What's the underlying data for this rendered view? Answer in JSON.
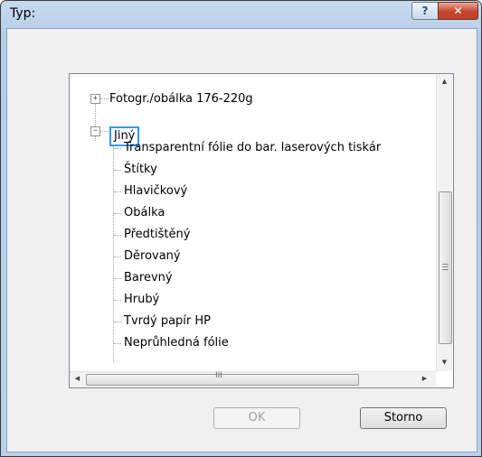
{
  "window": {
    "title": "Typ:",
    "help_label": "?",
    "close_label": "✕"
  },
  "tree": {
    "collapsed_item": "Fotogr./obálka 176-220g",
    "selected_item": "Jiný",
    "expander_plus": "+",
    "expander_minus": "−",
    "children": [
      "Transparentní fólie do bar. laserových tiskár",
      "Štítky",
      "Hlavičkový",
      "Obálka",
      "Předtištěný",
      "Děrovaný",
      "Barevný",
      "Hrubý",
      "Tvrdý papír HP",
      "Neprůhledná fólie"
    ]
  },
  "scrollbar": {
    "up_arrow": "▲",
    "down_arrow": "▼",
    "left_arrow": "◀",
    "right_arrow": "▶",
    "thumb_grip_h": "III"
  },
  "buttons": {
    "ok": "OK",
    "cancel": "Storno"
  }
}
